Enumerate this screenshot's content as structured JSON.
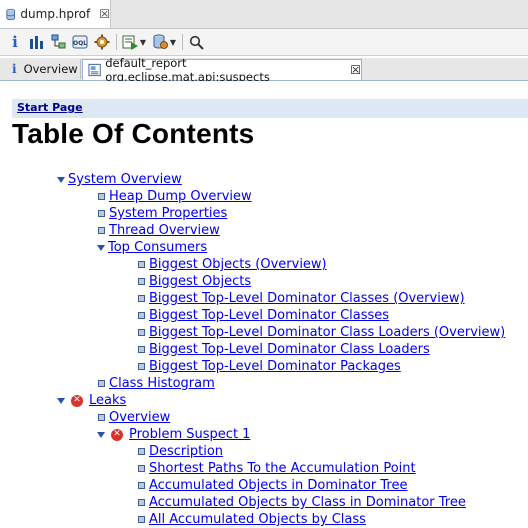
{
  "editor": {
    "file_tab": "dump.hprof",
    "close": "☒"
  },
  "toolbar": {
    "buttons": [
      "info-icon",
      "histogram-icon",
      "dominator-tree-icon",
      "oql-icon",
      "thread-gear-icon",
      "run-report-icon",
      "query-browser-icon",
      "search-icon"
    ]
  },
  "subtabs": {
    "overview": "Overview",
    "report": "default_report  org.eclipse.mat.api:suspects",
    "close": "☒"
  },
  "page": {
    "breadcrumb": "Start Page",
    "title": "Table Of Contents"
  },
  "toc": [
    {
      "text": "System Overview",
      "icon": "expand"
    },
    {
      "text": "Heap Dump Overview",
      "icon": "bullet"
    },
    {
      "text": "System Properties",
      "icon": "bullet"
    },
    {
      "text": "Thread Overview",
      "icon": "bullet"
    },
    {
      "text": "Top Consumers",
      "icon": "expand"
    },
    {
      "text": "Biggest Objects (Overview)",
      "icon": "bullet"
    },
    {
      "text": "Biggest Objects",
      "icon": "bullet"
    },
    {
      "text": "Biggest Top-Level Dominator Classes (Overview)",
      "icon": "bullet"
    },
    {
      "text": "Biggest Top-Level Dominator Classes",
      "icon": "bullet"
    },
    {
      "text": "Biggest Top-Level Dominator Class Loaders (Overview)",
      "icon": "bullet"
    },
    {
      "text": "Biggest Top-Level Dominator Class Loaders",
      "icon": "bullet"
    },
    {
      "text": "Biggest Top-Level Dominator Packages",
      "icon": "bullet"
    },
    {
      "text": "Class Histogram",
      "icon": "bullet"
    },
    {
      "text": "Leaks",
      "icon": "expand-error"
    },
    {
      "text": "Overview",
      "icon": "bullet"
    },
    {
      "text": "Problem Suspect 1",
      "icon": "expand-error"
    },
    {
      "text": "Description",
      "icon": "bullet"
    },
    {
      "text": "Shortest Paths To the Accumulation Point",
      "icon": "bullet"
    },
    {
      "text": "Accumulated Objects in Dominator Tree",
      "icon": "bullet"
    },
    {
      "text": "Accumulated Objects by Class in Dominator Tree",
      "icon": "bullet"
    },
    {
      "text": "All Accumulated Objects by Class",
      "icon": "bullet"
    }
  ],
  "colors": {
    "link": "#0000ee",
    "crumb_bg": "#dde8f3",
    "error": "#d8342c"
  }
}
